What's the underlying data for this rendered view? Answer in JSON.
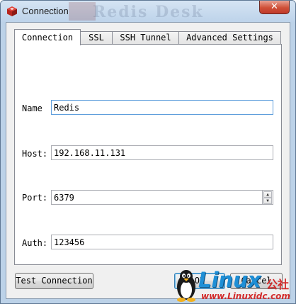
{
  "window": {
    "title": "Connection",
    "close_label": "✕",
    "background_title": "Redis Desk"
  },
  "tabs": [
    {
      "label": "Connection",
      "active": true
    },
    {
      "label": "SSL",
      "active": false
    },
    {
      "label": "SSH Tunnel",
      "active": false
    },
    {
      "label": "Advanced Settings",
      "active": false
    }
  ],
  "form": {
    "name": {
      "label": "Name",
      "value": "Redis"
    },
    "host": {
      "label": "Host:",
      "value": "192.168.11.131"
    },
    "port": {
      "label": "Port:",
      "value": "6379"
    },
    "auth": {
      "label": "Auth:",
      "value": "123456"
    }
  },
  "buttons": {
    "test_connection": "Test Connection",
    "ok": "OK",
    "cancel": "Cancel"
  },
  "watermark": {
    "brand": "Linux",
    "chinese": "公社",
    "url": "www.Linuxidc.com"
  },
  "icons": {
    "app": "redis-cube-icon",
    "close": "close-icon",
    "stepper_up": "chevron-up-icon",
    "stepper_down": "chevron-down-icon",
    "penguin": "tux-penguin-icon"
  },
  "colors": {
    "title_bar": "#bcd2e8",
    "close_button": "#c1392b",
    "focus_border": "#5d9ddb",
    "watermark_blue": "#1f8fd6",
    "watermark_red": "#d22c2c"
  }
}
